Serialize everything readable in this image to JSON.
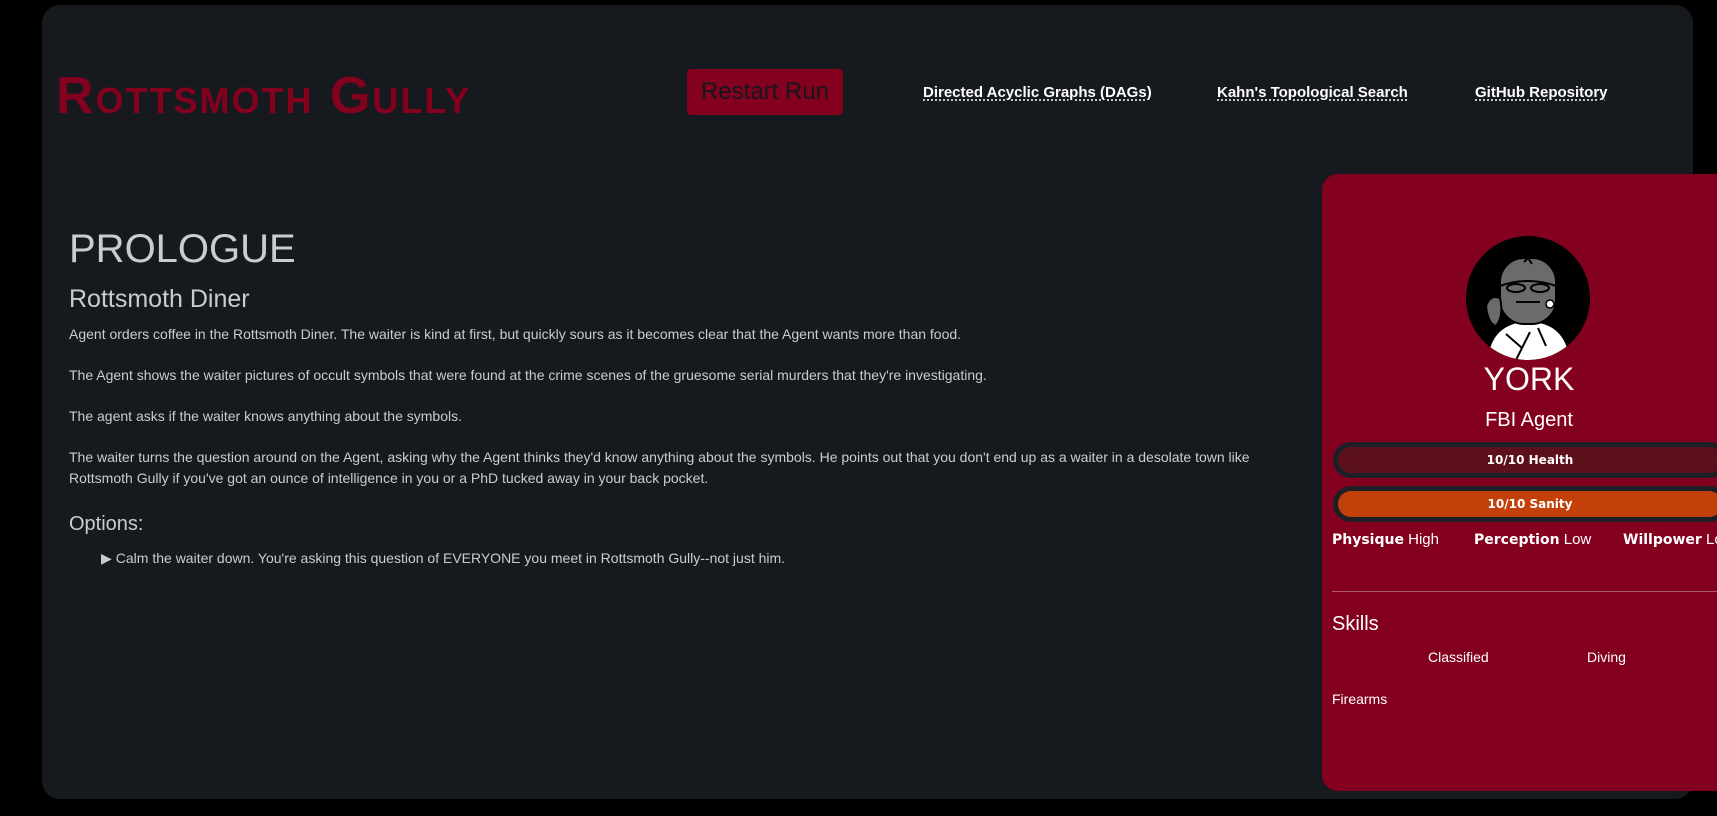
{
  "header": {
    "brand": "Rottsmoth Gully",
    "restart_label": "Restart Run",
    "links": [
      {
        "label": "Directed Acyclic Graphs (DAGs)"
      },
      {
        "label": "Kahn's Topological Search"
      },
      {
        "label": "GitHub Repository"
      }
    ]
  },
  "story": {
    "chapter": "PROLOGUE",
    "location": "Rottsmoth Diner",
    "paragraphs": [
      "Agent orders coffee in the Rottsmoth Diner. The waiter is kind at first, but quickly sours as it becomes clear that the Agent wants more than food.",
      "The Agent shows the waiter pictures of occult symbols that were found at the crime scenes of the gruesome serial murders that they're investigating.",
      "The agent asks if the waiter knows anything about the symbols.",
      "The waiter turns the question around on the Agent, asking why the Agent thinks they'd know anything about the symbols. He points out that you don't end up as a waiter in a desolate town like Rottsmoth Gully if you've got an ounce of intelligence in you or a PhD tucked away in your back pocket."
    ],
    "options_title": "Options:",
    "options": [
      {
        "marker": "▶",
        "text": "Calm the waiter down. You're asking this question of EVERYONE you meet in Rottsmoth Gully--not just him."
      }
    ]
  },
  "character": {
    "name": "YORK",
    "role": "FBI Agent",
    "avatar_icon": "agent-portrait",
    "health": {
      "label": "10/10 Health",
      "current": 10,
      "max": 10,
      "color": "#5c1019"
    },
    "sanity": {
      "label": "10/10 Sanity",
      "current": 10,
      "max": 10,
      "color": "#c2400a"
    },
    "attributes": [
      {
        "name": "Physique",
        "value": "High"
      },
      {
        "name": "Perception",
        "value": "Low"
      },
      {
        "name": "Willpower",
        "value": "Low"
      }
    ],
    "skills_title": "Skills",
    "skills": [
      "Classified",
      "Diving",
      "Firearms"
    ]
  },
  "colors": {
    "accent": "#84001f",
    "panel": "#161a1f",
    "text": "#c9ccd1"
  }
}
